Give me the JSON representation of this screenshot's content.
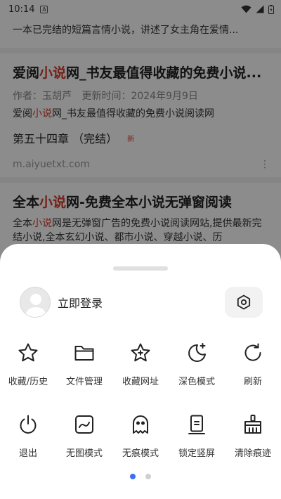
{
  "status_bar": {
    "time": "10:14",
    "notif_glyph": "A"
  },
  "results": {
    "top_snippet": "一本已完结的短篇言情小说，讲述了女主角在爱情...",
    "cards": [
      {
        "title_pre": "爱阅",
        "title_hl": "小说",
        "title_post": "网_书友最值得收藏的免费小说...",
        "author": "作者：玉胡芦",
        "updated": "更新时间：2024年9月9日",
        "desc_pre": "爱阅",
        "desc_hl": "小说",
        "desc_post": "网_书友最值得收藏的免费小说阅读网",
        "chapter": "第五十四章 （完结）",
        "badge": "新",
        "url": "m.aiyuetxt.com"
      },
      {
        "title_pre": "全本",
        "title_hl": "小说",
        "title_post": "网-免费全本小说无弹窗阅读",
        "desc_pre": "全本",
        "desc_hl": "小说",
        "desc_post": "网是无弹窗广告的免费小说阅读网站,提供最新完结小说,全本玄幻小说、都市小说、穿越小说、历"
      }
    ]
  },
  "menu": {
    "login_label": "立即登录",
    "row1": [
      {
        "icon": "star-icon",
        "label": "收藏/历史"
      },
      {
        "icon": "folder-icon",
        "label": "文件管理"
      },
      {
        "icon": "star-plus-icon",
        "label": "收藏网址"
      },
      {
        "icon": "moon-icon",
        "label": "深色模式"
      },
      {
        "icon": "refresh-icon",
        "label": "刷新"
      }
    ],
    "row2": [
      {
        "icon": "power-icon",
        "label": "退出"
      },
      {
        "icon": "no-image-icon",
        "label": "无图模式"
      },
      {
        "icon": "ghost-icon",
        "label": "无痕模式"
      },
      {
        "icon": "lock-portrait-icon",
        "label": "锁定竖屏"
      },
      {
        "icon": "broom-icon",
        "label": "清除痕迹"
      }
    ],
    "pager": {
      "pages": 2,
      "active": 1
    }
  },
  "colors": {
    "accent": "#3b6ef5",
    "highlight": "#d23a2a"
  }
}
